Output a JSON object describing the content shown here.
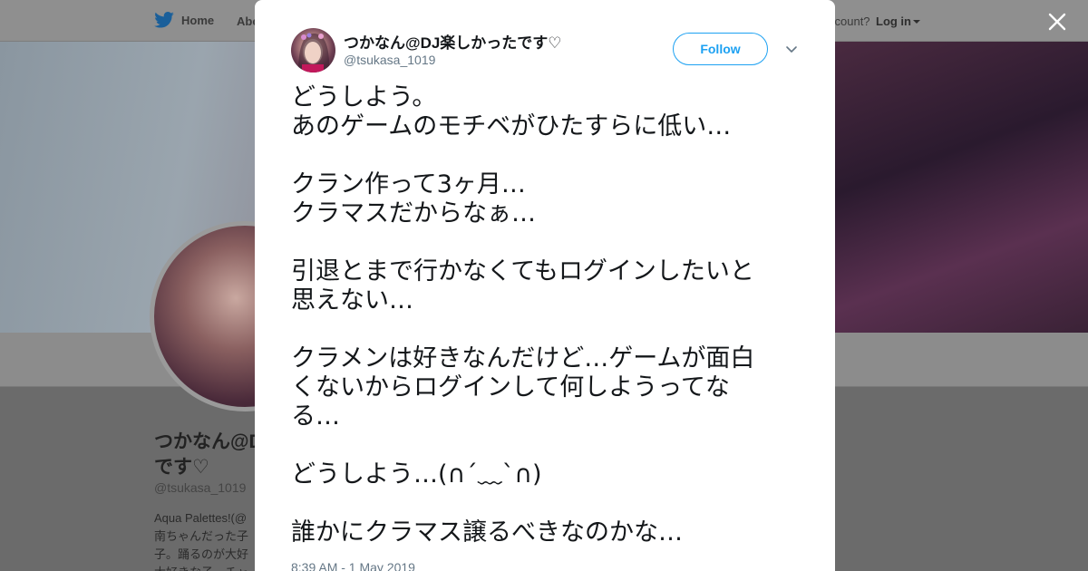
{
  "background_page": {
    "nav": {
      "home_label": "Home",
      "about_label": "Abo",
      "account_text": "ccount?",
      "login_label": "Log in"
    },
    "profile": {
      "name": "つかなん@D",
      "name_line2": "です♡",
      "handle": "@tsukasa_1019",
      "bio_lines": [
        "Aqua Palettes!(@",
        "南ちゃんだった子",
        "子。踊るのが大好",
        "大好きな子。チャ"
      ]
    }
  },
  "modal": {
    "author": {
      "name": "つかなん@DJ楽しかったです♡",
      "handle": "@tsukasa_1019"
    },
    "follow_label": "Follow",
    "tweet_lines": [
      "どうしよう。",
      "あのゲームのモチベがひたすらに低い…",
      "",
      "クラン作って3ヶ月…",
      "クラマスだからなぁ…",
      "",
      "引退とまで行かなくてもログインしたいと",
      "思えない…",
      "",
      "クラメンは好きなんだけど…ゲームが面白",
      "くないからログインして何しようってな",
      "る…",
      "",
      "どうしよう…(∩´﹏`∩)",
      "",
      "誰かにクラマス譲るべきなのかな…"
    ],
    "timestamp": "8:39 AM - 1 May 2019"
  },
  "colors": {
    "accent": "#1da1f2",
    "overlay": "#6b6b6b",
    "text": "#14171a",
    "secondary": "#657786"
  },
  "icons": [
    "twitter-bird-icon",
    "caret-down-icon",
    "chevron-down-icon",
    "close-icon"
  ]
}
